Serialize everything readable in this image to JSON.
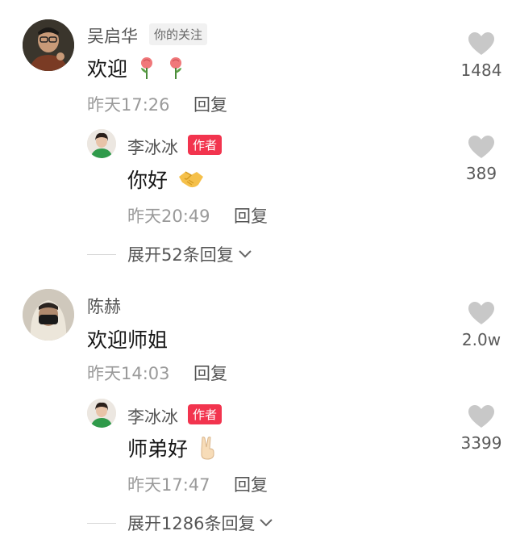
{
  "comments": [
    {
      "author": "吴启华",
      "follow_tag": "你的关注",
      "text": "欢迎",
      "time": "昨天17:26",
      "reply_label": "回复",
      "likes": "1484",
      "reply": {
        "author": "李冰冰",
        "author_tag": "作者",
        "text": "你好",
        "time": "昨天20:49",
        "reply_label": "回复",
        "likes": "389"
      },
      "expand_label": "展开52条回复"
    },
    {
      "author": "陈赫",
      "text": "欢迎师姐",
      "time": "昨天14:03",
      "reply_label": "回复",
      "likes": "2.0w",
      "reply": {
        "author": "李冰冰",
        "author_tag": "作者",
        "text": "师弟好",
        "time": "昨天17:47",
        "reply_label": "回复",
        "likes": "3399"
      },
      "expand_label": "展开1286条回复"
    }
  ],
  "icons": {
    "like": "heart-icon",
    "expand": "chevron-down-icon",
    "rose": "rose-emoji",
    "handshake": "handshake-emoji",
    "victory": "victory-hand-emoji"
  },
  "colors": {
    "author_tag": "#f2344e",
    "heart": "#c8c8c8"
  }
}
